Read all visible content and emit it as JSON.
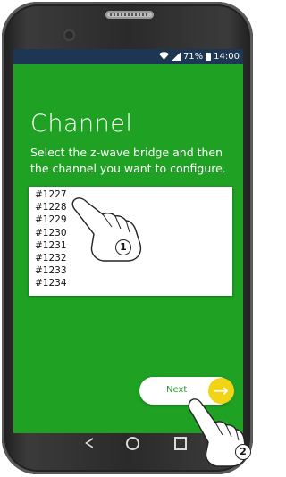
{
  "status_bar": {
    "battery": "71%",
    "time": "14:00"
  },
  "screen": {
    "title": "Channel",
    "instruction": "Select the z-wave bridge and then the channel you want to configure.",
    "channels": [
      "#1227",
      "#1228",
      "#1229",
      "#1230",
      "#1231",
      "#1232",
      "#1233",
      "#1234"
    ],
    "next_label": "Next",
    "next_arrow": "→"
  },
  "annotations": {
    "step1": "1",
    "step2": "2"
  },
  "colors": {
    "screen_bg": "#1fa124",
    "status_bar": "#1c3653",
    "accent": "#f3d316",
    "next_text": "#2b9a2e"
  },
  "icons": [
    "wifi-icon",
    "signal-icon",
    "battery-icon",
    "back-icon",
    "home-icon",
    "recents-icon",
    "arrow-right-icon",
    "pointing-hand-icon"
  ]
}
